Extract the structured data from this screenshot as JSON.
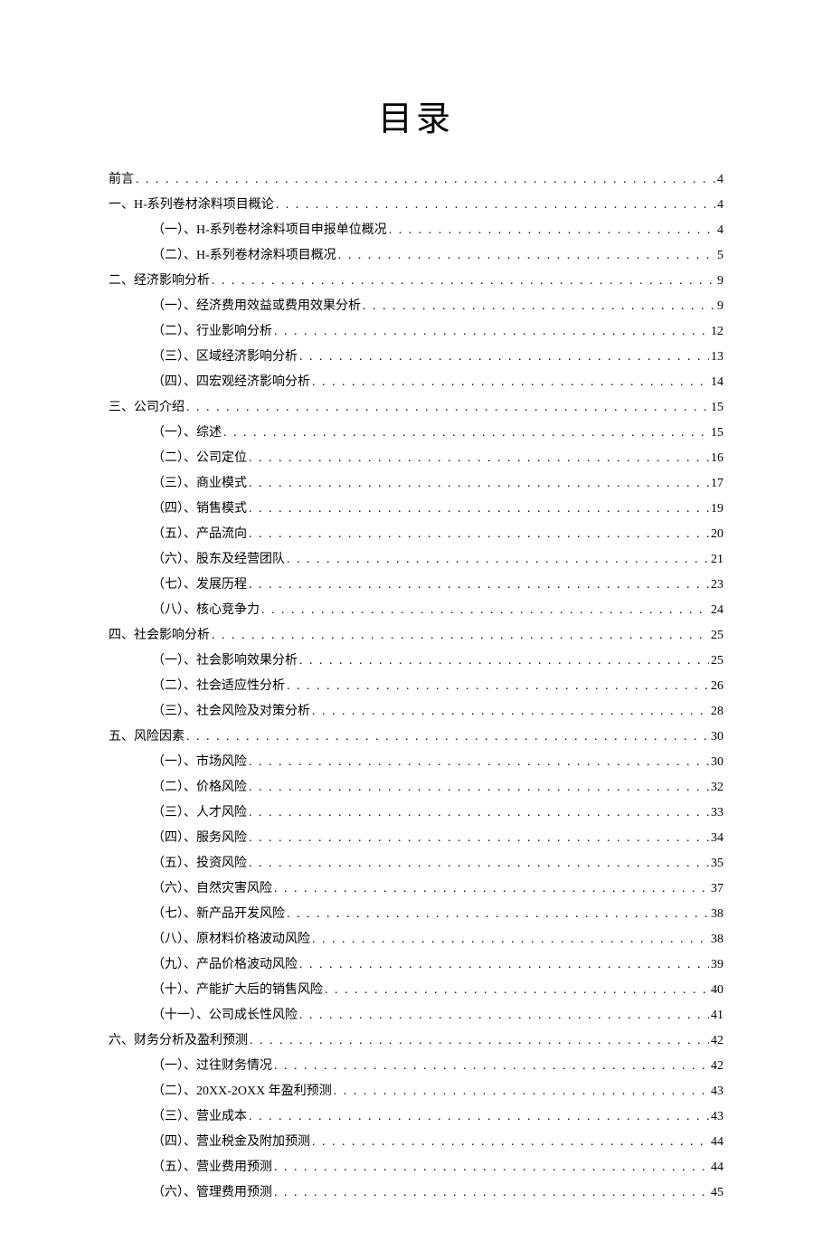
{
  "title": "目录",
  "entries": [
    {
      "level": 0,
      "label": "前言",
      "page": "4"
    },
    {
      "level": 0,
      "label": "一、H-系列卷材涂料项目概论",
      "page": "4"
    },
    {
      "level": 1,
      "label": "（一）、H-系列卷材涂料项目申报单位概况",
      "page": "4"
    },
    {
      "level": 1,
      "label": "（二）、H-系列卷材涂料项目概况",
      "page": "5"
    },
    {
      "level": 0,
      "label": "二、经济影响分析",
      "page": "9"
    },
    {
      "level": 1,
      "label": "（一）、经济费用效益或费用效果分析",
      "page": "9"
    },
    {
      "level": 1,
      "label": "（二）、行业影响分析",
      "page": "12"
    },
    {
      "level": 1,
      "label": "（三）、区域经济影响分析",
      "page": "13"
    },
    {
      "level": 1,
      "label": "（四）、四宏观经济影响分析",
      "page": "14"
    },
    {
      "level": 0,
      "label": "三、公司介绍",
      "page": "15"
    },
    {
      "level": 1,
      "label": "（一）、综述",
      "page": "15"
    },
    {
      "level": 1,
      "label": "（二）、公司定位",
      "page": "16"
    },
    {
      "level": 1,
      "label": "（三）、商业模式",
      "page": "17"
    },
    {
      "level": 1,
      "label": "（四）、销售模式",
      "page": "19"
    },
    {
      "level": 1,
      "label": "（五）、产品流向",
      "page": "20"
    },
    {
      "level": 1,
      "label": "（六）、股东及经营团队",
      "page": "21"
    },
    {
      "level": 1,
      "label": "（七）、发展历程",
      "page": "23"
    },
    {
      "level": 1,
      "label": "（八）、核心竞争力",
      "page": "24"
    },
    {
      "level": 0,
      "label": "四、社会影响分析",
      "page": "25"
    },
    {
      "level": 1,
      "label": "（一）、社会影响效果分析",
      "page": "25"
    },
    {
      "level": 1,
      "label": "（二）、社会适应性分析",
      "page": "26"
    },
    {
      "level": 1,
      "label": "（三）、社会风险及对策分析",
      "page": "28"
    },
    {
      "level": 0,
      "label": "五、风险因素",
      "page": "30"
    },
    {
      "level": 1,
      "label": "（一）、市场风险",
      "page": "30"
    },
    {
      "level": 1,
      "label": "（二）、价格风险",
      "page": "32"
    },
    {
      "level": 1,
      "label": "（三）、人才风险",
      "page": "33"
    },
    {
      "level": 1,
      "label": "（四）、服务风险",
      "page": "34"
    },
    {
      "level": 1,
      "label": "（五）、投资风险",
      "page": "35"
    },
    {
      "level": 1,
      "label": "（六）、自然灾害风险",
      "page": "37"
    },
    {
      "level": 1,
      "label": "（七）、新产品开发风险",
      "page": "38"
    },
    {
      "level": 1,
      "label": "（八）、原材料价格波动风险",
      "page": "38"
    },
    {
      "level": 1,
      "label": "（九）、产品价格波动风险",
      "page": "39"
    },
    {
      "level": 1,
      "label": "（十）、产能扩大后的销售风险",
      "page": "40"
    },
    {
      "level": 1,
      "label": "（十一）、公司成长性风险",
      "page": "41"
    },
    {
      "level": 0,
      "label": "六、财务分析及盈利预测",
      "page": "42"
    },
    {
      "level": 1,
      "label": "（一）、过往财务情况",
      "page": "42"
    },
    {
      "level": 1,
      "label": "（二）、20XX-2OXX 年盈利预测",
      "page": "43"
    },
    {
      "level": 1,
      "label": "（三）、营业成本",
      "page": "43"
    },
    {
      "level": 1,
      "label": "（四）、营业税金及附加预测",
      "page": "44"
    },
    {
      "level": 1,
      "label": "（五）、营业费用预测",
      "page": "44"
    },
    {
      "level": 1,
      "label": "（六）、管理费用预测",
      "page": "45"
    }
  ]
}
